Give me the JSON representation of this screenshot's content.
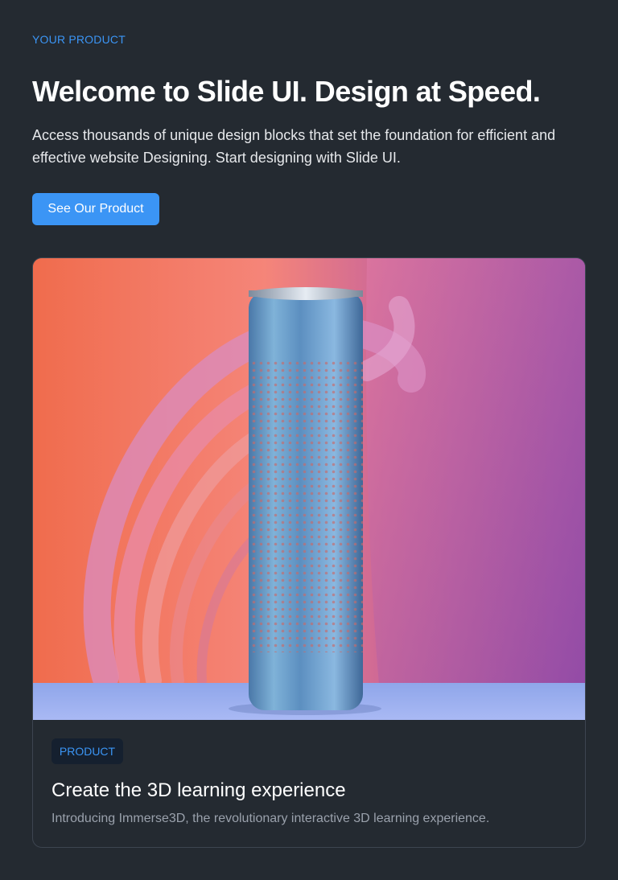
{
  "hero": {
    "eyebrow": "YOUR PRODUCT",
    "title": "Welcome to Slide UI. Design at Speed.",
    "description": "Access thousands of unique design blocks that set the foundation for efficient and effective website Designing. Start designing with Slide UI.",
    "cta_label": "See Our Product"
  },
  "card": {
    "image_subject": "cylindrical smart speaker with perforated blue metal body on coral and purple background with curved ribbons",
    "badge": "PRODUCT",
    "title": "Create the 3D learning experience",
    "description": "Introducing Immerse3D, the revolutionary interactive 3D learning experience."
  },
  "colors": {
    "page_background": "#242a31",
    "accent": "#3b95f5",
    "badge_background": "#15202f",
    "card_border": "#3d4550",
    "muted_text": "#9aa1ac"
  }
}
